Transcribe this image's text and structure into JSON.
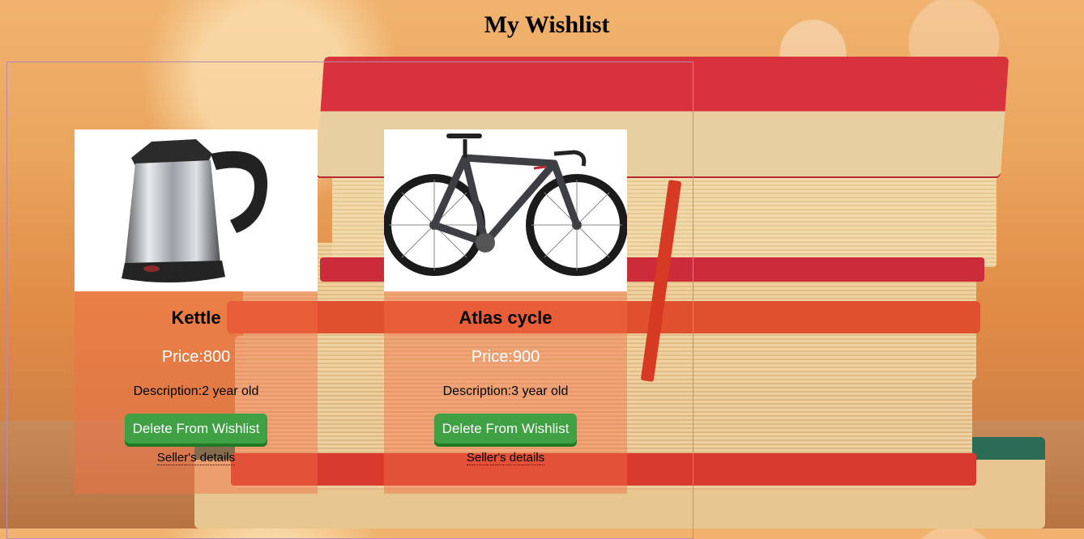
{
  "page": {
    "title": "My Wishlist"
  },
  "items": [
    {
      "name": "Kettle",
      "price": "Price:800",
      "description": "Description:2 year old",
      "delete_label": "Delete From Wishlist",
      "seller_label": "Seller's details",
      "image_icon": "kettle-image"
    },
    {
      "name": "Atlas cycle",
      "price": "Price:900",
      "description": "Description:3 year old",
      "delete_label": "Delete From Wishlist",
      "seller_label": "Seller's details",
      "image_icon": "bicycle-image"
    }
  ],
  "colors": {
    "button_green": "#3fa144",
    "card_overlay": "#f26e46",
    "frame_border": "#b58ab3"
  }
}
